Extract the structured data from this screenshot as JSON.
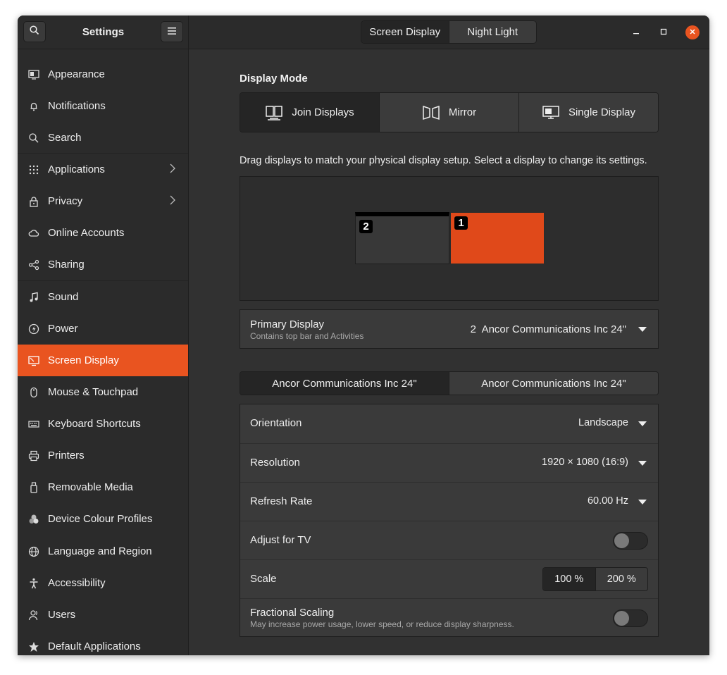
{
  "app": {
    "title": "Settings"
  },
  "header": {
    "tabs": [
      {
        "label": "Screen Display",
        "active": true
      },
      {
        "label": "Night Light",
        "active": false
      }
    ]
  },
  "sidebar": {
    "items": [
      {
        "label": "Appearance",
        "icon": "appearance-icon"
      },
      {
        "label": "Notifications",
        "icon": "bell-icon"
      },
      {
        "label": "Search",
        "icon": "search-icon"
      },
      {
        "label": "Applications",
        "icon": "apps-grid-icon",
        "has_chevron": true
      },
      {
        "label": "Privacy",
        "icon": "lock-icon",
        "has_chevron": true
      },
      {
        "label": "Online Accounts",
        "icon": "cloud-icon"
      },
      {
        "label": "Sharing",
        "icon": "share-icon"
      },
      {
        "label": "Sound",
        "icon": "music-note-icon"
      },
      {
        "label": "Power",
        "icon": "power-icon"
      },
      {
        "label": "Screen Display",
        "icon": "display-icon",
        "selected": true
      },
      {
        "label": "Mouse & Touchpad",
        "icon": "mouse-icon"
      },
      {
        "label": "Keyboard Shortcuts",
        "icon": "keyboard-icon"
      },
      {
        "label": "Printers",
        "icon": "printer-icon"
      },
      {
        "label": "Removable Media",
        "icon": "usb-drive-icon"
      },
      {
        "label": "Device Colour Profiles",
        "icon": "colour-profiles-icon"
      },
      {
        "label": "Language and Region",
        "icon": "globe-icon"
      },
      {
        "label": "Accessibility",
        "icon": "accessibility-icon"
      },
      {
        "label": "Users",
        "icon": "users-icon"
      },
      {
        "label": "Default Applications",
        "icon": "star-icon"
      }
    ]
  },
  "display_mode": {
    "title": "Display Mode",
    "options": [
      {
        "label": "Join Displays",
        "active": true
      },
      {
        "label": "Mirror",
        "active": false
      },
      {
        "label": "Single Display",
        "active": false
      }
    ]
  },
  "arrangement": {
    "hint": "Drag displays to match your physical display setup. Select a display to change its settings.",
    "monitors": [
      {
        "number": "2",
        "primary": true,
        "selected": false
      },
      {
        "number": "1",
        "primary": false,
        "selected": true
      }
    ]
  },
  "primary_display": {
    "title": "Primary Display",
    "subtitle": "Contains top bar and Activities",
    "number": "2",
    "value": "Ancor Communications Inc 24\""
  },
  "monitor_tabs": [
    {
      "label": "Ancor Communications Inc 24\"",
      "active": true
    },
    {
      "label": "Ancor Communications Inc 24\"",
      "active": false
    }
  ],
  "settings": {
    "orientation": {
      "label": "Orientation",
      "value": "Landscape"
    },
    "resolution": {
      "label": "Resolution",
      "value": "1920 × 1080 (16:9)"
    },
    "refresh_rate": {
      "label": "Refresh Rate",
      "value": "60.00 Hz"
    },
    "adjust_tv": {
      "label": "Adjust for TV",
      "enabled": false
    },
    "scale": {
      "label": "Scale",
      "options": [
        "100 %",
        "200 %"
      ],
      "selected": "100 %"
    },
    "fractional_scaling": {
      "label": "Fractional Scaling",
      "subtitle": "May increase power usage, lower speed, or reduce display sharpness.",
      "enabled": false
    }
  },
  "colors": {
    "accent": "#e95420",
    "window_bg": "#313131",
    "sidebar_bg": "#2b2b2b",
    "text": "#eeeeee"
  }
}
